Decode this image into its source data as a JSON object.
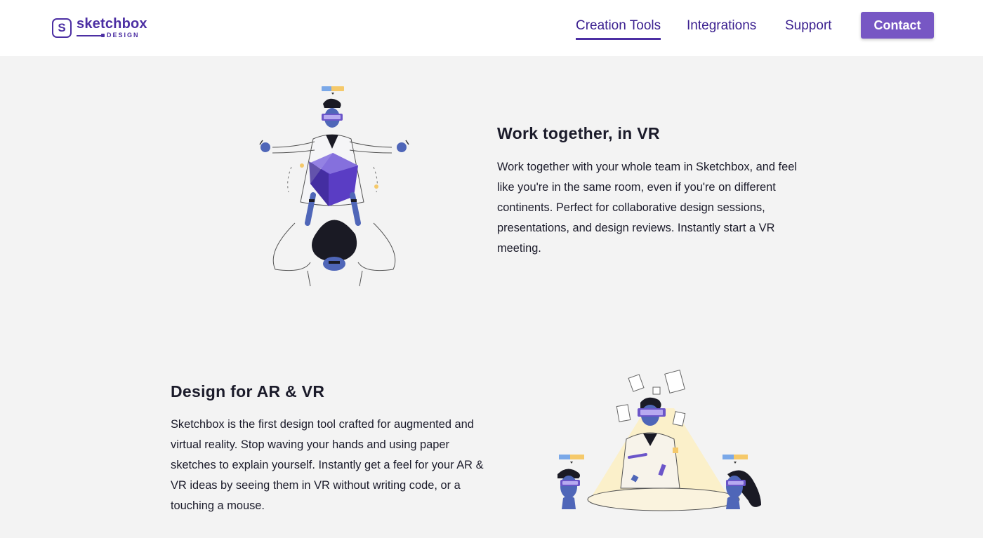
{
  "header": {
    "logo": {
      "mark": "S",
      "name": "sketchbox",
      "sub": "DESIGN"
    },
    "nav": [
      {
        "label": "Creation Tools",
        "active": true
      },
      {
        "label": "Integrations",
        "active": false
      },
      {
        "label": "Support",
        "active": false
      }
    ],
    "contact_label": "Contact"
  },
  "sections": [
    {
      "heading": "Work together, in VR",
      "body": "Work together with your whole team in Sketchbox, and feel like you're in the same room, even if you're on different continents. Perfect for collaborative design sessions, presentations, and design reviews. Instantly start a VR meeting.",
      "illustration": "two-people-vr-cube-illustration"
    },
    {
      "heading": "Design for AR & VR",
      "body": "Sketchbox is the first design tool crafted for augmented and virtual reality. Stop waving your hands and using paper sketches to explain yourself. Instantly get a feel for your AR & VR ideas by seeing them in VR without writing code, or a touching a mouse.",
      "illustration": "designer-presenting-vr-illustration"
    }
  ],
  "colors": {
    "brand": "#4c2fa3",
    "button": "#7757c4",
    "background": "#f3f3f3"
  }
}
